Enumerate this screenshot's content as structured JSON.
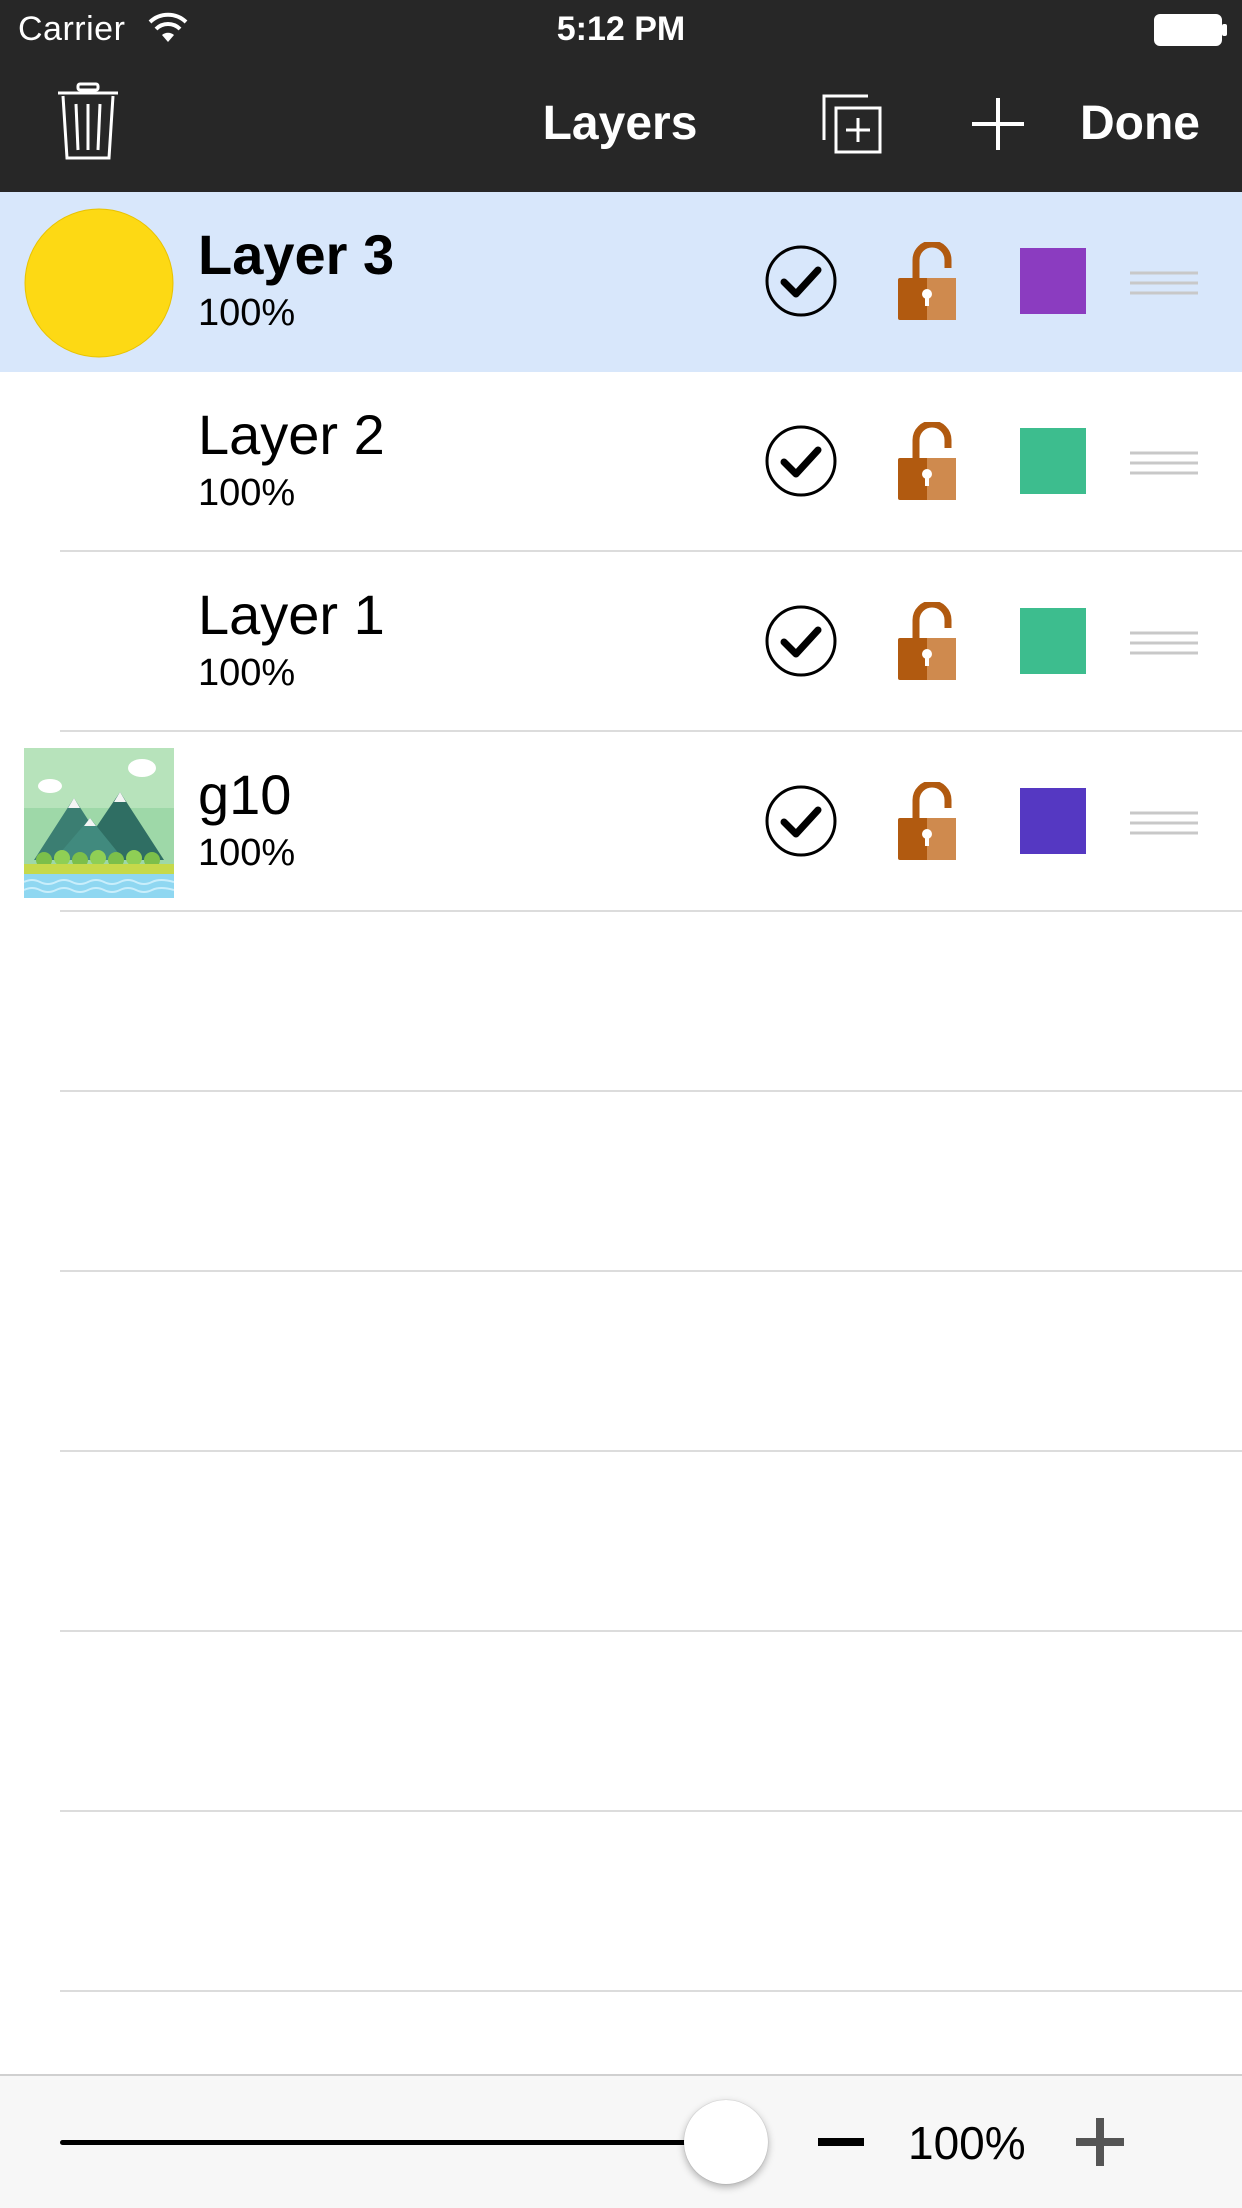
{
  "status_bar": {
    "carrier": "Carrier",
    "time": "5:12 PM",
    "wifi_icon": "wifi-icon",
    "battery_icon": "battery-full-icon"
  },
  "nav": {
    "title": "Layers",
    "done_label": "Done",
    "trash_icon": "trash-icon",
    "duplicate_icon": "duplicate-layer-icon",
    "add_icon": "plus-icon"
  },
  "layers": [
    {
      "name": "Layer 3",
      "opacity": "100%",
      "selected": true,
      "thumbnail": "yellow-circle",
      "visible": true,
      "locked": false,
      "color": "#8b3cc0"
    },
    {
      "name": "Layer 2",
      "opacity": "100%",
      "selected": false,
      "thumbnail": "none",
      "visible": true,
      "locked": false,
      "color": "#3dbd8e"
    },
    {
      "name": "Layer 1",
      "opacity": "100%",
      "selected": false,
      "thumbnail": "none",
      "visible": true,
      "locked": false,
      "color": "#3dbd8e"
    },
    {
      "name": "g10",
      "opacity": "100%",
      "selected": false,
      "thumbnail": "mountain-landscape",
      "visible": true,
      "locked": false,
      "color": "#5538c2"
    }
  ],
  "toolbar": {
    "zoom_value": "100%",
    "slider_level": 0.95,
    "minus_icon": "minus-icon",
    "plus_icon": "plus-icon"
  },
  "colors": {
    "nav_background": "#272727",
    "selected_row": "#d8e7fb",
    "lock_color": "#b15a10"
  }
}
